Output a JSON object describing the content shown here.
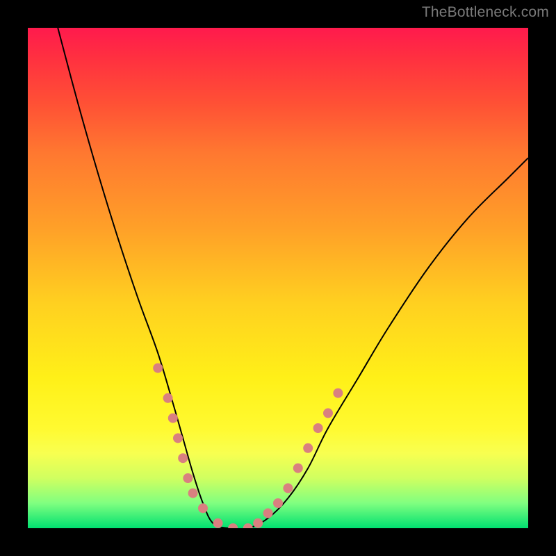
{
  "watermark": "TheBottleneck.com",
  "chart_data": {
    "type": "line",
    "title": "",
    "xlabel": "",
    "ylabel": "",
    "x_range": [
      0,
      100
    ],
    "y_range": [
      0,
      100
    ],
    "grid": false,
    "legend": false,
    "background": {
      "style": "vertical-gradient",
      "stops": [
        {
          "pos": 0.0,
          "color": "#ff1a4d"
        },
        {
          "pos": 0.15,
          "color": "#ff5035"
        },
        {
          "pos": 0.4,
          "color": "#ffa028"
        },
        {
          "pos": 0.7,
          "color": "#fff018"
        },
        {
          "pos": 0.9,
          "color": "#d0ff60"
        },
        {
          "pos": 1.0,
          "color": "#00e070"
        }
      ]
    },
    "series": [
      {
        "name": "bottleneck-curve",
        "color": "#000000",
        "stroke_width": 2,
        "x": [
          6,
          10,
          14,
          18,
          22,
          26,
          29,
          31,
          33,
          35,
          37,
          40,
          44,
          48,
          52,
          56,
          60,
          66,
          72,
          80,
          88,
          96,
          100
        ],
        "y": [
          100,
          85,
          71,
          58,
          46,
          35,
          25,
          18,
          11,
          5,
          1,
          0,
          0,
          2,
          6,
          12,
          20,
          30,
          40,
          52,
          62,
          70,
          74
        ]
      }
    ],
    "markers": [
      {
        "name": "left-branch-dots",
        "color": "#d98080",
        "radius": 7,
        "points": [
          {
            "x": 26,
            "y": 32
          },
          {
            "x": 28,
            "y": 26
          },
          {
            "x": 29,
            "y": 22
          },
          {
            "x": 30,
            "y": 18
          },
          {
            "x": 31,
            "y": 14
          },
          {
            "x": 32,
            "y": 10
          },
          {
            "x": 33,
            "y": 7
          },
          {
            "x": 35,
            "y": 4
          }
        ]
      },
      {
        "name": "valley-dots",
        "color": "#d98080",
        "radius": 7,
        "points": [
          {
            "x": 38,
            "y": 1
          },
          {
            "x": 41,
            "y": 0
          },
          {
            "x": 44,
            "y": 0
          },
          {
            "x": 46,
            "y": 1
          }
        ]
      },
      {
        "name": "right-branch-dots",
        "color": "#d98080",
        "radius": 7,
        "points": [
          {
            "x": 48,
            "y": 3
          },
          {
            "x": 50,
            "y": 5
          },
          {
            "x": 52,
            "y": 8
          },
          {
            "x": 54,
            "y": 12
          },
          {
            "x": 56,
            "y": 16
          },
          {
            "x": 58,
            "y": 20
          },
          {
            "x": 60,
            "y": 23
          },
          {
            "x": 62,
            "y": 27
          }
        ]
      }
    ]
  }
}
